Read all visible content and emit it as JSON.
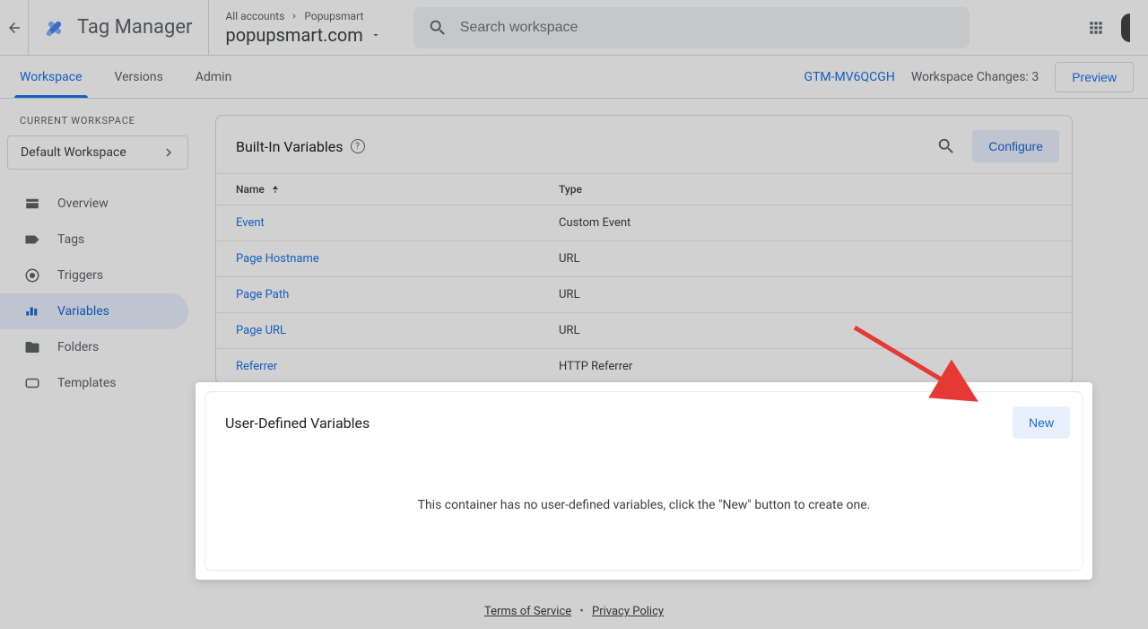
{
  "header": {
    "product": "Tag Manager",
    "breadcrumb": {
      "all": "All accounts",
      "account": "Popupsmart"
    },
    "container": "popupsmart.com",
    "search_placeholder": "Search workspace"
  },
  "subheader": {
    "tabs": [
      "Workspace",
      "Versions",
      "Admin"
    ],
    "gtm_id": "GTM-MV6QCGH",
    "changes_label": "Workspace Changes:",
    "changes_count": "3",
    "preview": "Preview"
  },
  "sidebar": {
    "label": "CURRENT WORKSPACE",
    "workspace": "Default Workspace",
    "items": [
      "Overview",
      "Tags",
      "Triggers",
      "Variables",
      "Folders",
      "Templates"
    ]
  },
  "builtins": {
    "title": "Built-In Variables",
    "configure": "Configure",
    "cols": {
      "name": "Name",
      "type": "Type"
    },
    "rows": [
      {
        "name": "Event",
        "type": "Custom Event"
      },
      {
        "name": "Page Hostname",
        "type": "URL"
      },
      {
        "name": "Page Path",
        "type": "URL"
      },
      {
        "name": "Page URL",
        "type": "URL"
      },
      {
        "name": "Referrer",
        "type": "HTTP Referrer"
      }
    ]
  },
  "userdef": {
    "title": "User-Defined Variables",
    "new": "New",
    "empty": "This container has no user-defined variables, click the \"New\" button to create one."
  },
  "footer": {
    "tos": "Terms of Service",
    "privacy": "Privacy Policy"
  }
}
